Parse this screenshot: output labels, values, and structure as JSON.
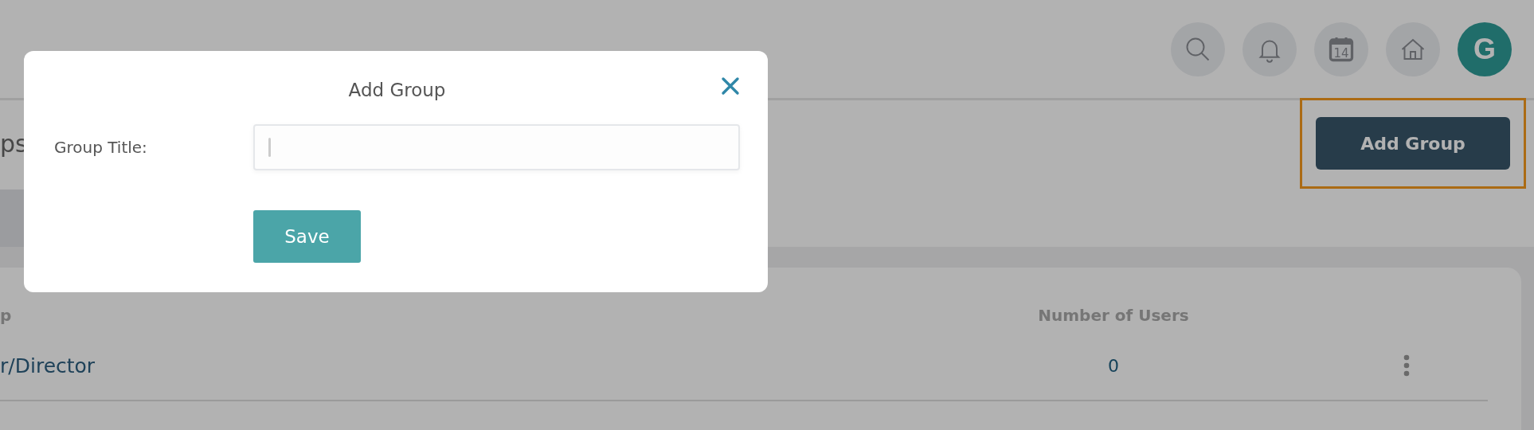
{
  "header": {
    "icons": [
      {
        "kind": "search"
      },
      {
        "kind": "bell"
      },
      {
        "kind": "calendar",
        "label": "14"
      },
      {
        "kind": "home"
      }
    ],
    "avatar": {
      "initial": "G"
    }
  },
  "page": {
    "title": "ps",
    "add_button": {
      "label": "Add Group",
      "highlighted": true
    }
  },
  "table": {
    "columns": [
      "p",
      "Number of Users"
    ],
    "rows": [
      {
        "name": "r/Director",
        "users": "0"
      }
    ]
  },
  "modal": {
    "title": "Add Group",
    "field_label": "Group Title:",
    "save_label": "Save"
  }
}
